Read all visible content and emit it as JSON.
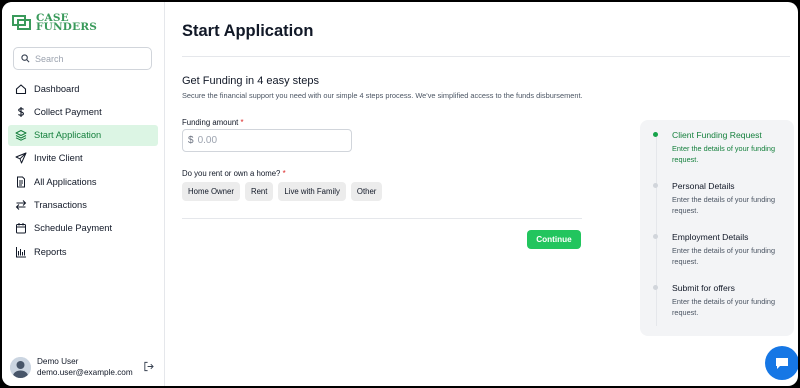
{
  "brand": {
    "line1": "CASE",
    "line2": "FUNDERS",
    "color": "#3a9a5b"
  },
  "search": {
    "placeholder": "Search"
  },
  "sidebar": {
    "items": [
      {
        "label": "Dashboard",
        "icon": "home-icon",
        "active": false
      },
      {
        "label": "Collect Payment",
        "icon": "dollar-icon",
        "active": false
      },
      {
        "label": "Start Application",
        "icon": "layers-icon",
        "active": true
      },
      {
        "label": "Invite Client",
        "icon": "send-icon",
        "active": false
      },
      {
        "label": "All Applications",
        "icon": "document-icon",
        "active": false
      },
      {
        "label": "Transactions",
        "icon": "arrows-exchange-icon",
        "active": false
      },
      {
        "label": "Schedule Payment",
        "icon": "calendar-icon",
        "active": false
      },
      {
        "label": "Reports",
        "icon": "bar-chart-icon",
        "active": false
      }
    ]
  },
  "user": {
    "name": "Demo User",
    "email": "demo.user@example.com"
  },
  "main": {
    "title": "Start Application",
    "steps_heading": "Get Funding in 4 easy steps",
    "steps_subheading": "Secure the financial support you need with our simple 4 steps process. We've simplified access to the funds disbursement.",
    "funding_label": "Funding amount",
    "required_mark": "*",
    "currency_symbol": "$",
    "amount_placeholder": "0.00",
    "home_question": "Do you rent or own a home?",
    "home_options": [
      "Home Owner",
      "Rent",
      "Live with Family",
      "Other"
    ],
    "continue_label": "Continue"
  },
  "progress": {
    "steps": [
      {
        "title": "Client Funding Request",
        "desc": "Enter the details of your funding request.",
        "active": true
      },
      {
        "title": "Personal Details",
        "desc": "Enter the details of your funding request.",
        "active": false
      },
      {
        "title": "Employment Details",
        "desc": "Enter the details of your funding request.",
        "active": false
      },
      {
        "title": "Submit for offers",
        "desc": "Enter the details of your funding request.",
        "active": false
      }
    ]
  },
  "colors": {
    "accent": "#22c55e",
    "active_bg": "#dcf5e4",
    "active_text": "#15803d",
    "chat": "#1677e5"
  }
}
